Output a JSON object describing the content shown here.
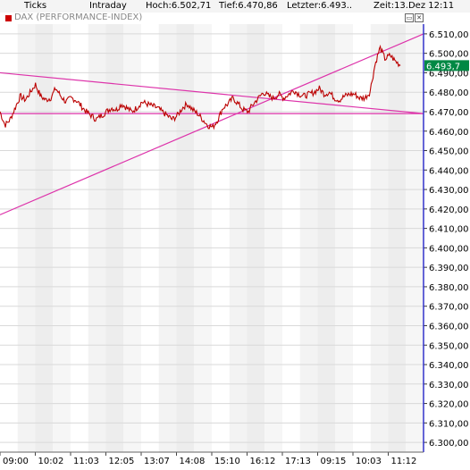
{
  "header": {
    "ticks_label": "Ticks",
    "intraday_label": "Intraday",
    "high_text": "Hoch:6.502,71",
    "low_text": "Tief:6.470,86",
    "last_text": "Letzter:6.493..",
    "time_text": "Zeit:13.Dez 12:11"
  },
  "legend": {
    "label": "DAX (PERFORMANCE-INDEX)"
  },
  "window_buttons": {
    "restore_glyph": "▭",
    "close_glyph": "✕"
  },
  "colors": {
    "series": "#bb0000",
    "trendlines": "#dd33aa",
    "last_value_badge": "#008844",
    "band_light": "#ededed",
    "cursor_line": "#3333cc"
  },
  "chart_data": {
    "type": "line",
    "title": "DAX (PERFORMANCE-INDEX)",
    "ylim": [
      6295,
      6515
    ],
    "yticks": [
      6300,
      6310,
      6320,
      6330,
      6340,
      6350,
      6360,
      6370,
      6380,
      6390,
      6400,
      6410,
      6420,
      6430,
      6440,
      6450,
      6460,
      6470,
      6480,
      6490,
      6500,
      6510
    ],
    "ytick_labels": [
      "6.300,00",
      "6.310,00",
      "6.320,00",
      "6.330,00",
      "6.340,00",
      "6.350,00",
      "6.360,00",
      "6.370,00",
      "6.380,00",
      "6.390,00",
      "6.400,00",
      "6.410,00",
      "6.420,00",
      "6.430,00",
      "6.440,00",
      "6.450,00",
      "6.460,00",
      "6.470,00",
      "6.480,00",
      "6.490,00",
      "6.500,00",
      "6.510,00"
    ],
    "xtick_labels": [
      "09:00",
      "10:02",
      "11:03",
      "12:05",
      "13:07",
      "14:08",
      "15:10",
      "16:12",
      "17:13",
      "09:15",
      "10:03",
      "11:12"
    ],
    "high": 6502.71,
    "low": 6470.86,
    "last_value": 6493.7,
    "last_value_label": "6.493,7",
    "series": [
      {
        "values": [
          6470,
          6463,
          6466,
          6472,
          6478,
          6476,
          6480,
          6484,
          6478,
          6476,
          6477,
          6482,
          6478,
          6475,
          6477,
          6476,
          6473,
          6470,
          6468,
          6466,
          6468,
          6470,
          6472,
          6471,
          6474,
          6472,
          6470,
          6472,
          6475,
          6474,
          6473,
          6472,
          6470,
          6468,
          6466,
          6468,
          6472,
          6474,
          6471,
          6469,
          6466,
          6463,
          6462,
          6466,
          6472,
          6474,
          6477,
          6474,
          6471,
          6470,
          6474,
          6477,
          6480,
          6478,
          6477,
          6479,
          6477,
          6479,
          6481,
          6479,
          6478,
          6479,
          6480,
          6482,
          6479,
          6480,
          6477,
          6476,
          6478,
          6479,
          6479,
          6477,
          6477,
          6480,
          6494,
          6503,
          6497,
          6499,
          6496,
          6494
        ]
      }
    ],
    "trendlines": [
      {
        "from": [
          0,
          6490
        ],
        "to": [
          1,
          6469
        ]
      },
      {
        "from": [
          0,
          6417
        ],
        "to": [
          1,
          6510
        ]
      },
      {
        "from": [
          0,
          6469
        ],
        "to": [
          1,
          6469
        ]
      }
    ]
  }
}
